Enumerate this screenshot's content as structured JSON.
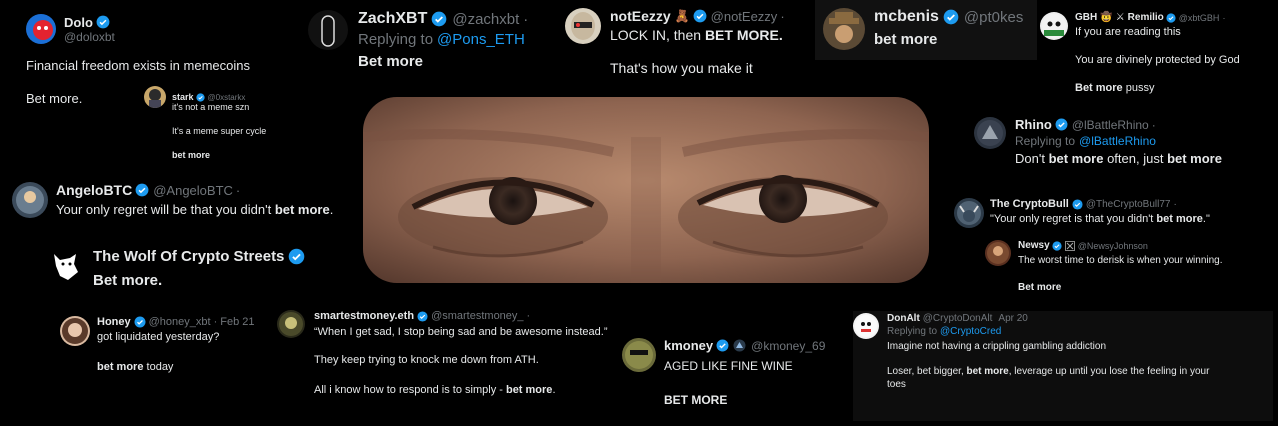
{
  "tweets": {
    "dolo": {
      "name": "Dolo",
      "handle": "@doloxbt",
      "line1": "Financial freedom exists in memecoins",
      "line2": "Bet more."
    },
    "stark": {
      "name": "stark",
      "handle": "@0xstarkx",
      "line1": "it's not a meme szn",
      "line2": "It's a meme super cycle",
      "line3": "bet more"
    },
    "zachxbt": {
      "name": "ZachXBT",
      "handle": "@zachxbt",
      "dot": "·",
      "replying": "Replying to",
      "reply_to": "@Pons_ETH",
      "text": "Bet more"
    },
    "noteezzy": {
      "name": "notEezzy",
      "emoji": "🧸",
      "handle": "@notEezzy",
      "dot": "·",
      "text_a": "LOCK IN, then ",
      "text_b": "BET MORE.",
      "line2": "That's how you make it"
    },
    "mcbenis": {
      "name": "mcbenis",
      "handle": "@pt0kes",
      "text": "bet more"
    },
    "gbh": {
      "name": "GBH",
      "emoji": "🤠",
      "swords": "⚔",
      "name2": "Remilio",
      "handle": "@xbtGBH",
      "dot": "·",
      "line1": "If you are reading this",
      "line2": "You are divinely protected by God",
      "line3a": "Bet more",
      "line3b": " pussy"
    },
    "rhino": {
      "name": "Rhino",
      "handle": "@lBattleRhino",
      "dot": "·",
      "replying": "Replying to",
      "reply_to": "@lBattleRhino",
      "text_a": "Don't ",
      "text_b": "bet more",
      "text_c": " often, just ",
      "text_d": "bet more"
    },
    "angelo": {
      "name": "AngeloBTC",
      "handle": "@AngeloBTC",
      "dot": "·",
      "text_a": "Your only regret will be that you didn't ",
      "text_b": "bet more",
      "text_c": "."
    },
    "wolf": {
      "name": "The Wolf Of Crypto Streets",
      "text": "Bet more."
    },
    "cryptobull": {
      "name": "The CryptoBull",
      "handle": "@TheCryptoBull77",
      "dot": "·",
      "text_a": "\"Your only regret is that you didn't ",
      "text_b": "bet more",
      "text_c": ".\""
    },
    "newsy": {
      "name": "Newsy",
      "handle": "@NewsyJohnson",
      "line1": "The worst time to derisk is when your winning.",
      "line2": "Bet more"
    },
    "honey": {
      "name": "Honey",
      "handle": "@honey_xbt",
      "date": "· Feb 21",
      "line1": "got liquidated yesterday?",
      "line2a": "bet more",
      "line2b": " today"
    },
    "smartest": {
      "name": "smartestmoney.eth",
      "handle": "@smartestmoney_",
      "dot": "·",
      "line1": "“When I get sad, I stop being sad and be awesome instead.”",
      "line2": "They keep trying to knock me down from ATH.",
      "line3a": "All i know how to respond is to simply - ",
      "line3b": "bet more",
      "line3c": "."
    },
    "kmoney": {
      "name": "kmoney",
      "handle": "@kmoney_69",
      "line1": "AGED LIKE FINE WINE",
      "line2": "BET MORE"
    },
    "donalt": {
      "name": "DonAlt",
      "handle": "@CryptoDonAlt",
      "date": "Apr 20",
      "replying": "Replying to",
      "reply_to": "@CryptoCred",
      "line1": "Imagine not having a crippling gambling addiction",
      "line2a": "Loser, bet bigger, ",
      "line2b": "bet more",
      "line2c": ", leverage up until you lose the feeling in your",
      "line3": "toes"
    }
  },
  "colors": {
    "verified": "#1d9bf0",
    "link": "#1d9bf0",
    "handle": "#71767b",
    "text": "#e7e9ea",
    "background": "#000000"
  }
}
